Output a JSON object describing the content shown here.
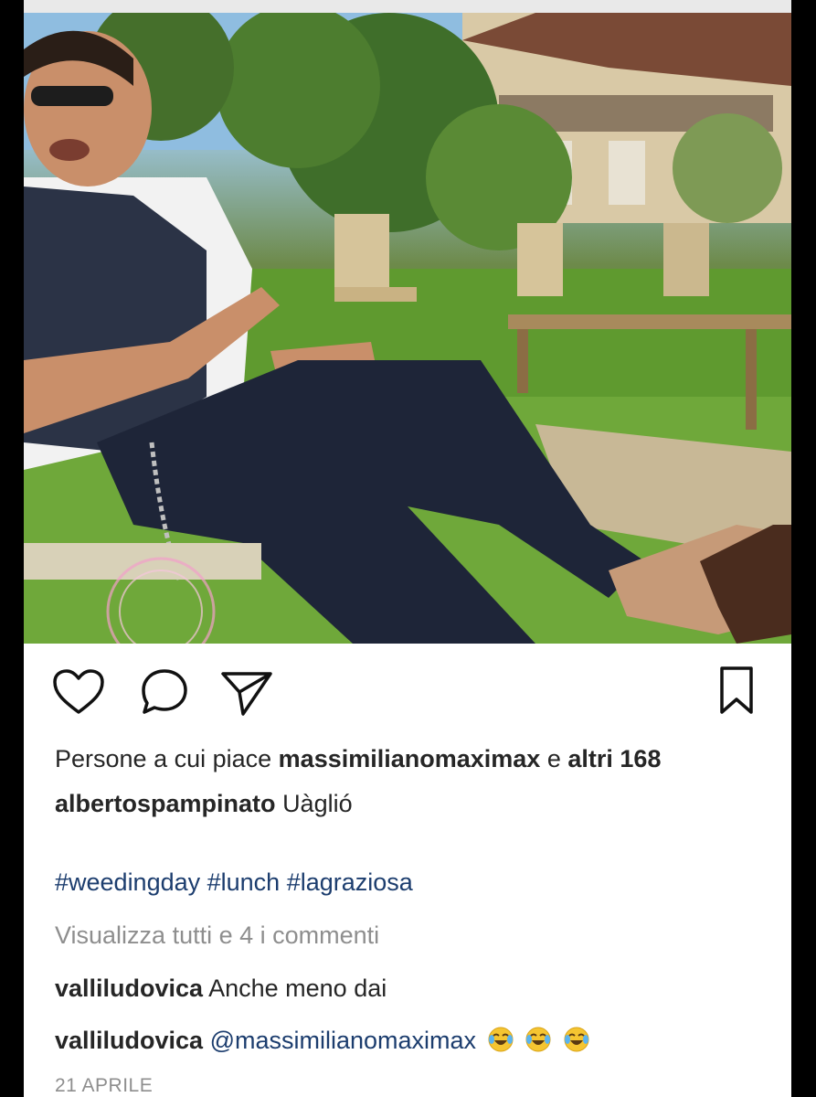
{
  "post": {
    "likes_prefix": "Persone a cui piace",
    "liked_by_user": "massimilianomaximax",
    "likes_connector": "e",
    "likes_others": "altri 168",
    "author": "albertospampinato",
    "caption": "Uàglió",
    "hashtags": "#weedingday #lunch #lagraziosa",
    "view_all_comments": "Visualizza tutti e 4 i commenti",
    "comments": [
      {
        "user": "valliludovica",
        "text": "Anche meno dai"
      },
      {
        "user": "valliludovica",
        "text": "@massimilianomaximax"
      }
    ],
    "date": "21 APRILE"
  },
  "icons": {
    "like": "heart-icon",
    "comment": "comment-bubble-icon",
    "share": "paper-plane-icon",
    "save": "bookmark-icon",
    "laugh_emoji": "tears-of-joy-emoji"
  },
  "colors": {
    "text": "#262626",
    "hashtag": "#1c3d6e",
    "muted": "#8e8e8e",
    "background": "#ffffff"
  }
}
